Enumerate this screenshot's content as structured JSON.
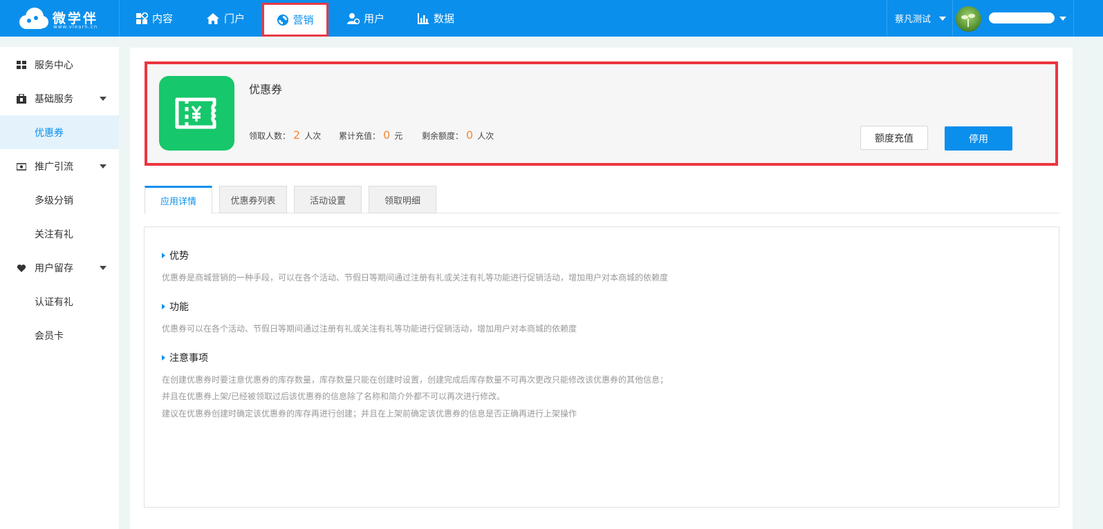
{
  "brand": {
    "name": "微学伴",
    "sub": "www.vlearn.cn",
    "color": "#0a8fec"
  },
  "nav": {
    "items": [
      {
        "label": "内容",
        "icon": "content-icon"
      },
      {
        "label": "门户",
        "icon": "home-icon"
      },
      {
        "label": "营销",
        "icon": "marketing-icon",
        "active": true
      },
      {
        "label": "用户",
        "icon": "user-icon"
      },
      {
        "label": "数据",
        "icon": "chart-icon"
      }
    ]
  },
  "account": {
    "org": "蔡凡测试"
  },
  "sidebar": {
    "items": [
      {
        "label": "服务中心",
        "icon": "grid-icon"
      },
      {
        "label": "基础服务",
        "icon": "briefcase-icon"
      },
      {
        "label": "优惠券",
        "active": true
      },
      {
        "label": "推广引流",
        "icon": "money-icon"
      },
      {
        "label": "多级分销"
      },
      {
        "label": "关注有礼"
      },
      {
        "label": "用户留存",
        "icon": "heart-icon"
      },
      {
        "label": "认证有礼"
      },
      {
        "label": "会员卡"
      }
    ]
  },
  "app": {
    "title": "优惠券",
    "icon_color": "#17c76b",
    "stats": [
      {
        "label": "领取人数：",
        "value": "2",
        "unit": "人次"
      },
      {
        "label": "累计充值：",
        "value": "0",
        "unit": "元"
      },
      {
        "label": "剩余额度：",
        "value": "0",
        "unit": "人次"
      }
    ],
    "quota_button": "额度充值",
    "stop_button": "停用"
  },
  "tabs": [
    "应用详情",
    "优惠券列表",
    "活动设置",
    "领取明细"
  ],
  "details": {
    "advantage_title": "优势",
    "advantage_text": "优惠券是商城营销的一种手段，可以在各个活动、节假日等期间通过注册有礼或关注有礼等功能进行促销活动，增加用户对本商城的依赖度",
    "function_title": "功能",
    "function_text": "优惠券可以在各个活动、节假日等期间通过注册有礼或关注有礼等功能进行促销活动，增加用户对本商城的依赖度",
    "notes_title": "注意事项",
    "notes": [
      "在创建优惠券时要注意优惠券的库存数量，库存数量只能在创建时设置，创建完成后库存数量不可再次更改只能修改该优惠券的其他信息；",
      "并且在优惠券上架/已经被领取过后该优惠券的信息除了名称和简介外都不可以再次进行修改。",
      "建议在优惠券创建时确定该优惠券的库存再进行创建；并且在上架前确定该优惠券的信息是否正确再进行上架操作"
    ]
  }
}
